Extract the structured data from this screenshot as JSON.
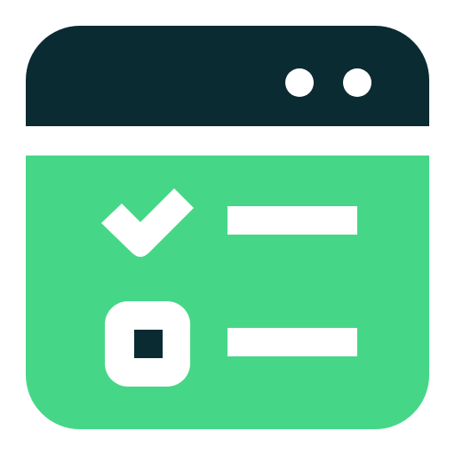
{
  "icon": {
    "name": "browser-checklist-icon",
    "colors": {
      "title_bar": "#0B2B33",
      "content": "#45D787",
      "foreground": "#FFFFFF",
      "checkbox_fill": "#0B2B33"
    }
  },
  "title_bar": {
    "controls": [
      {
        "name": "window-control-dot-1"
      },
      {
        "name": "window-control-dot-2"
      }
    ]
  },
  "checklist": {
    "items": [
      {
        "state": "checked"
      },
      {
        "state": "unchecked"
      }
    ]
  }
}
